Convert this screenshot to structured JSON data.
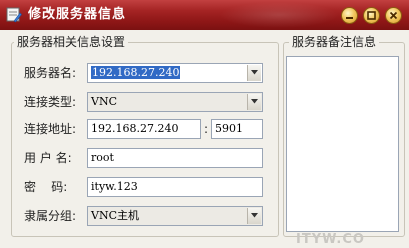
{
  "window": {
    "title": "修改服务器信息"
  },
  "titlebar": {
    "buttons": [
      {
        "name": "minimize",
        "icon": "minimize-icon"
      },
      {
        "name": "maximize",
        "icon": "maximize-icon"
      },
      {
        "name": "close",
        "icon": "close-icon"
      }
    ],
    "button_color": "#f2c760",
    "bar_color": "#a52424"
  },
  "server_info_group": {
    "legend": "服务器相关信息设置",
    "name_label": "服务器名:",
    "name_value": "192.168.27.240",
    "type_label": "连接类型:",
    "type_value": "VNC",
    "address_label": "连接地址:",
    "address_value": "192.168.27.240",
    "port_separator": ":",
    "port_value": "5901",
    "username_label": "用 户 名:",
    "username_value": "root",
    "password_label": "密    码:",
    "password_value": "ityw.123",
    "group_label": "隶属分组:",
    "group_value": "VNC主机"
  },
  "notes_group": {
    "legend": "服务器备注信息",
    "notes_value": ""
  },
  "watermark": {
    "text": "ITYW.CO"
  }
}
